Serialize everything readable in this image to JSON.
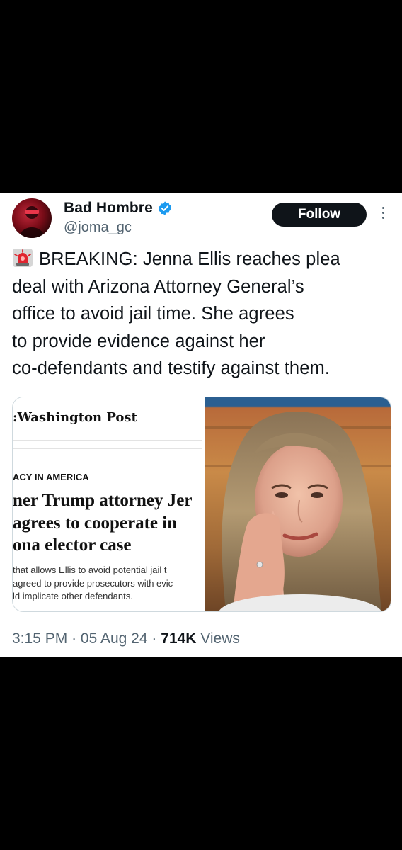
{
  "tweet": {
    "display_name": "Bad Hombre",
    "handle": "@joma_gc",
    "follow_label": "Follow",
    "text_lines": [
      "BREAKING: Jenna Ellis reaches plea",
      "deal with Arizona Attorney General’s",
      "office to avoid jail time. She agrees",
      "to provide evidence against her",
      "co-defendants and testify against them."
    ],
    "icons": [
      "verified-badge-icon",
      "more-options-icon",
      "siren-emoji-icon"
    ],
    "accent_color": "#1d9bf0"
  },
  "media": {
    "masthead": ":Washington Post",
    "kicker": "ACY IN AMERICA",
    "headline_lines": [
      "ner Trump attorney Jer",
      "agrees to cooperate in",
      "ona elector case"
    ],
    "sub_lines": [
      "that allows Ellis to avoid potential jail t",
      "agreed to provide prosecutors with evic",
      "ld implicate other defendants."
    ]
  },
  "meta": {
    "time": "3:15 PM",
    "date": "05 Aug 24",
    "views_count": "714K",
    "views_label": "Views",
    "separator": "·"
  }
}
